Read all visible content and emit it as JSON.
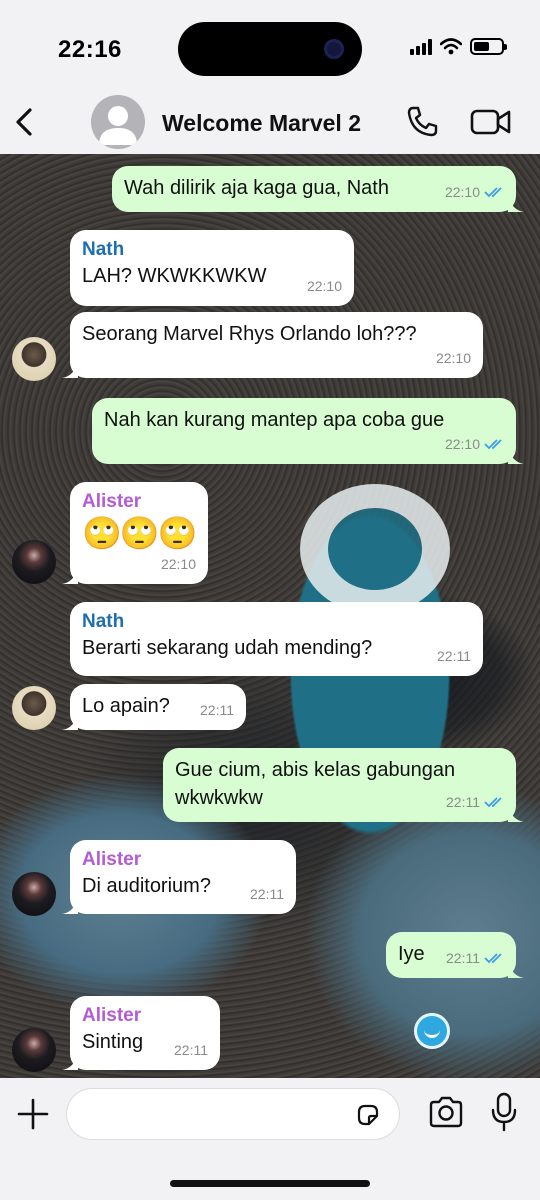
{
  "status_bar": {
    "time": "22:16"
  },
  "header": {
    "title": "Welcome Marvel 2"
  },
  "colors": {
    "outgoing_bubble": "#d9fdd3",
    "incoming_bubble": "#ffffff",
    "nath_name": "#1f6fb0",
    "alister_name": "#b45bd6",
    "tick_blue": "#3b9cf0"
  },
  "messages": [
    {
      "dir": "out",
      "text": "Wah dilirik aja kaga gua, Nath",
      "time": "22:10",
      "read": true
    },
    {
      "dir": "in",
      "sender": "Nath",
      "text": "LAH? WKWKKWKW",
      "time": "22:10"
    },
    {
      "dir": "in",
      "text": "Seorang Marvel Rhys Orlando loh???",
      "time": "22:10"
    },
    {
      "dir": "out",
      "text": "Nah kan kurang mantep apa coba gue",
      "time": "22:10",
      "read": true
    },
    {
      "dir": "in",
      "sender": "Alister",
      "text": "🙄🙄🙄",
      "time": "22:10"
    },
    {
      "dir": "in",
      "sender": "Nath",
      "text": "Berarti sekarang udah mending?",
      "time": "22:11"
    },
    {
      "dir": "in",
      "text": "Lo apain?",
      "time": "22:11"
    },
    {
      "dir": "out",
      "text_line1": "Gue cium, abis kelas gabungan",
      "text_line2": "wkwkwkw",
      "time": "22:11",
      "read": true
    },
    {
      "dir": "in",
      "sender": "Alister",
      "text": "Di auditorium?",
      "time": "22:11"
    },
    {
      "dir": "out",
      "text": "Iye",
      "time": "22:11",
      "read": true
    },
    {
      "dir": "in",
      "sender": "Alister",
      "text": "Sinting",
      "time": "22:11"
    }
  ],
  "icons": {
    "back": "chevron-left-icon",
    "call": "phone-icon",
    "video": "video-camera-icon",
    "plus": "plus-icon",
    "sticker": "sticker-icon",
    "camera": "camera-icon",
    "mic": "microphone-icon"
  }
}
